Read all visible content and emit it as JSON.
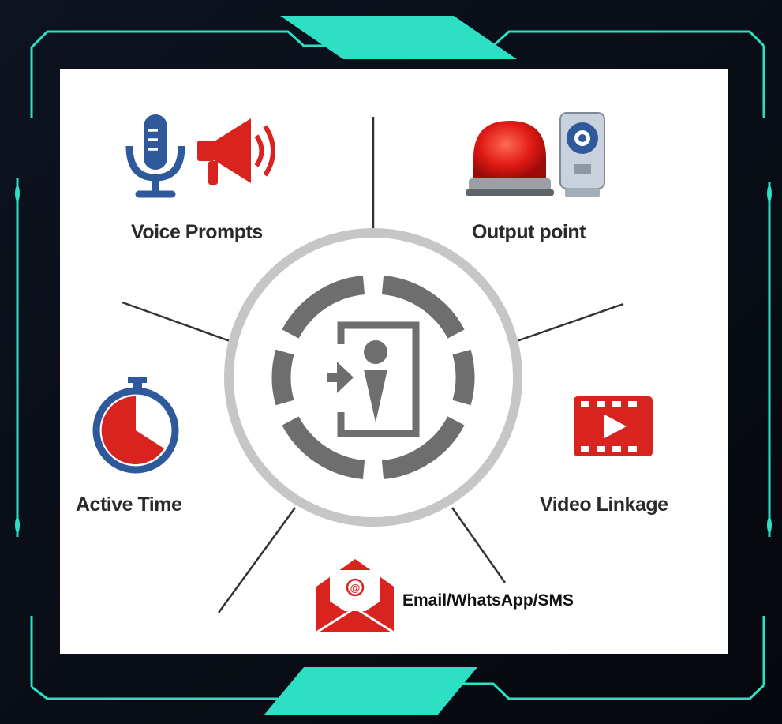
{
  "diagram": {
    "center": "center-door-entry-icon",
    "features": [
      {
        "label": "Voice Prompts",
        "icons": [
          "microphone-icon",
          "megaphone-icon"
        ]
      },
      {
        "label": "Output point",
        "icons": [
          "siren-alarm-icon",
          "camera-icon"
        ]
      },
      {
        "label": "Active Time",
        "icons": [
          "stopwatch-icon"
        ]
      },
      {
        "label": "Video Linkage",
        "icons": [
          "video-play-icon"
        ]
      },
      {
        "label": "Email/WhatsApp/SMS",
        "icons": [
          "email-envelope-icon"
        ]
      }
    ]
  },
  "colors": {
    "frame": "#2de0c4",
    "accent_red": "#d9231f",
    "accent_blue": "#2e5a9c",
    "ring_gray": "#6e6e6e"
  }
}
